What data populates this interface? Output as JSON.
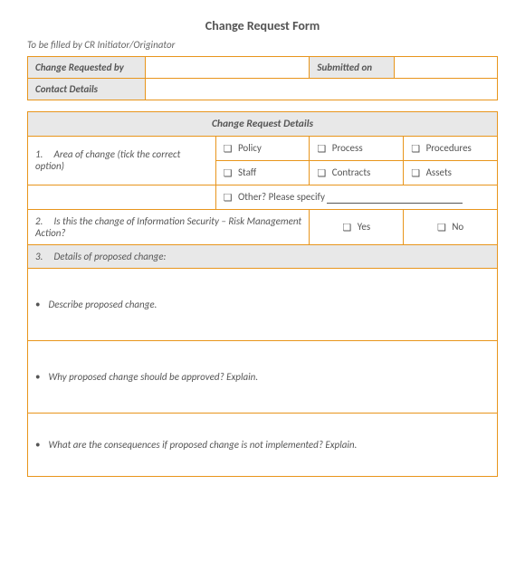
{
  "title": "Change Request Form",
  "subtitle": "To be filled by CR Initiator/Originator",
  "header_table": {
    "requested_by_label": "Change Requested by",
    "requested_by_value": "",
    "submitted_on_label": "Submitted on",
    "submitted_on_value": "",
    "contact_label": "Contact Details",
    "contact_value": ""
  },
  "section2_title": "Change Request Details",
  "row1": {
    "num": "1.",
    "label": "Area of change (tick  the correct option)",
    "options": {
      "policy": "Policy",
      "process": "Process",
      "procedures": "Procedures",
      "staff": "Staff",
      "contracts": "Contracts",
      "assets": "Assets",
      "other": "Other? Please specify"
    }
  },
  "row2": {
    "num": "2.",
    "label": "Is this the change of Information Security – Risk Management Action?",
    "yes": "Yes",
    "no": "No"
  },
  "row3": {
    "num": "3.",
    "label": "Details of proposed change:"
  },
  "q1": "Describe proposed change.",
  "q2": "Why proposed change should be approved? Explain.",
  "q3": "What are the consequences if proposed change is not implemented? Explain."
}
